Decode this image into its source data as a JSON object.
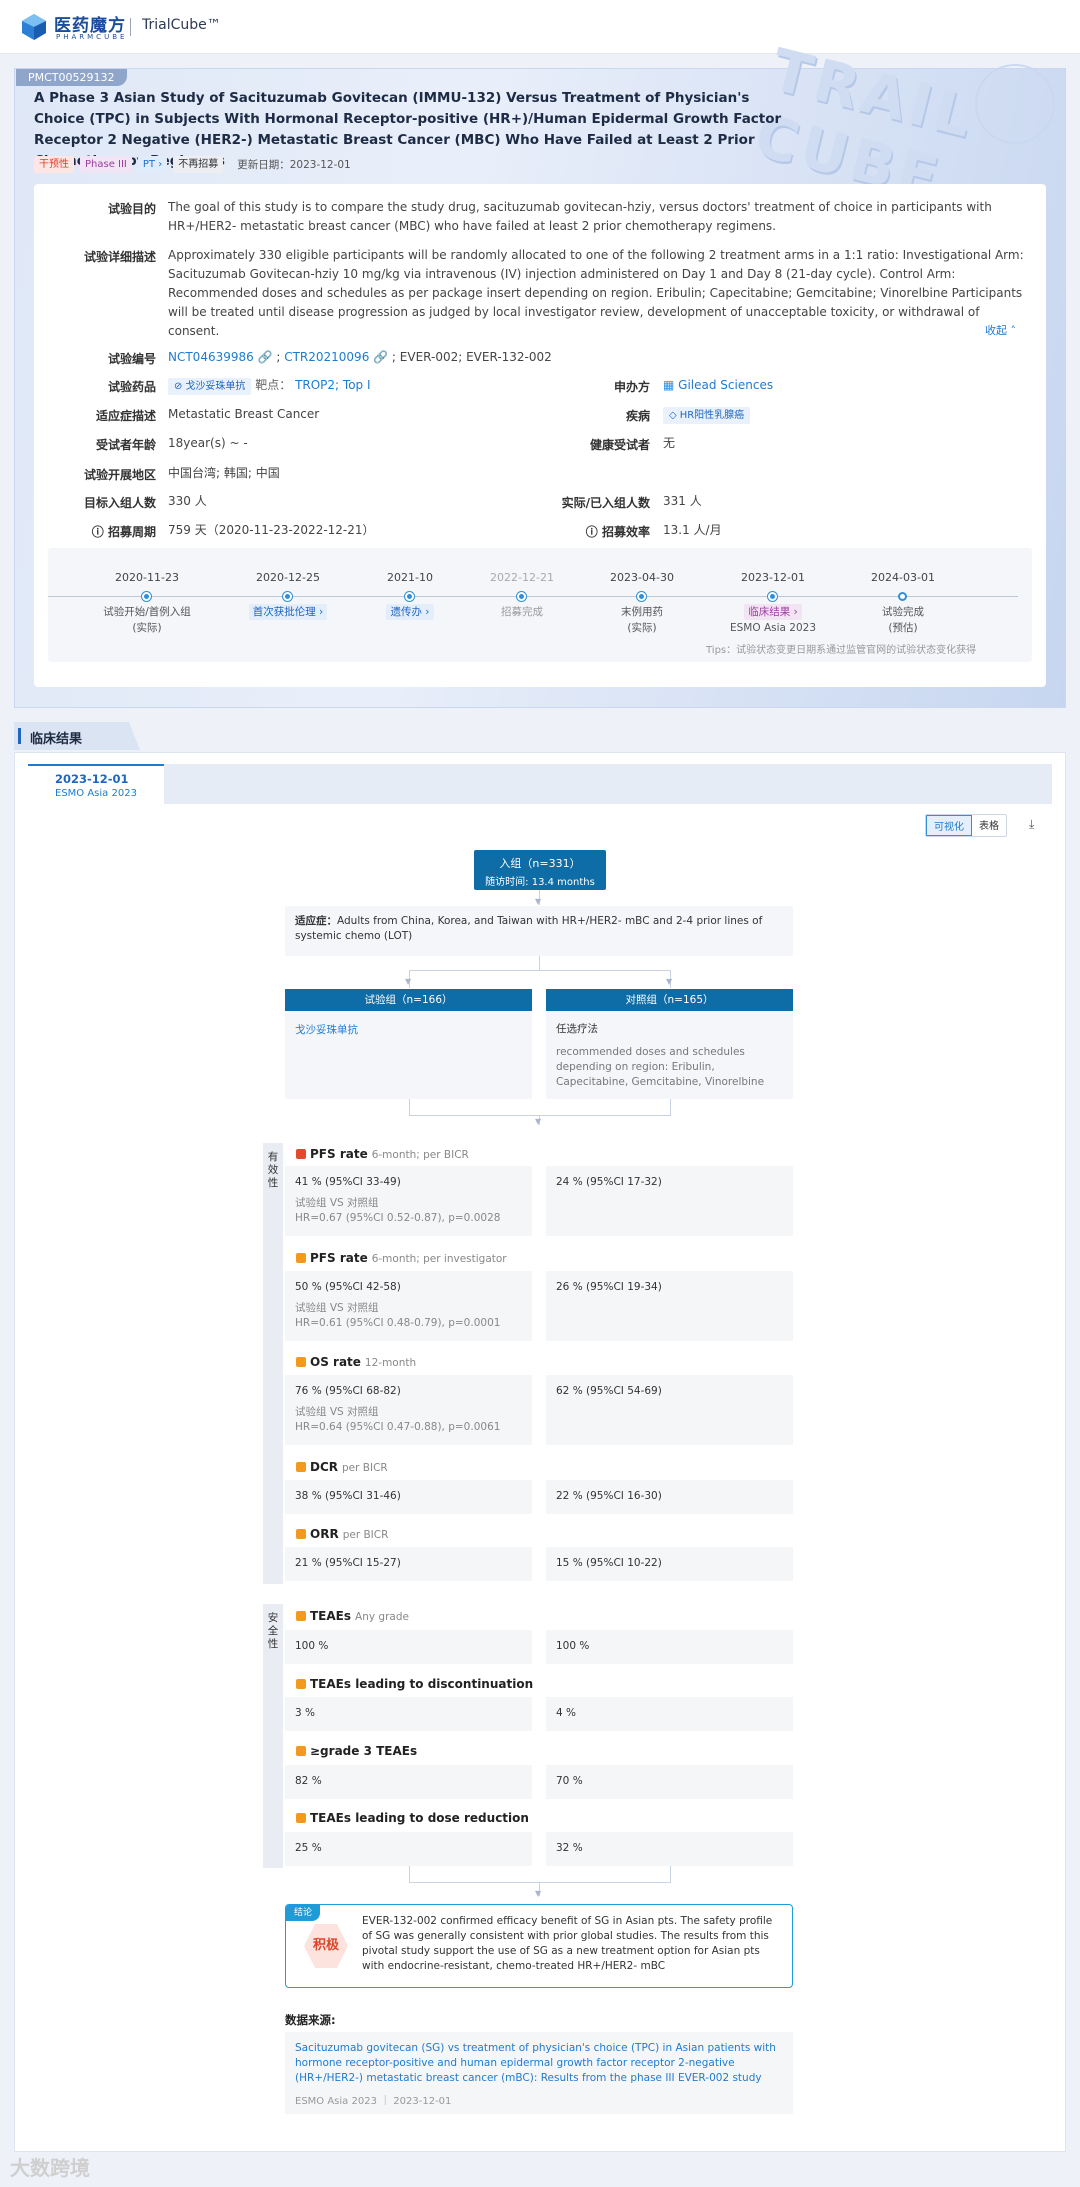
{
  "header": {
    "logo_cn": "医药魔方",
    "logo_en": "PHARMCUBE",
    "product": "TrialCube™"
  },
  "trial": {
    "id": "PMCT00529132",
    "title": "A Phase 3 Asian Study of Sacituzumab Govitecan (IMMU-132) Versus Treatment of Physician's Choice (TPC) in Subjects With Hormonal Receptor-positive (HR+)/Human Epidermal Growth Factor Receptor 2 Negative (HER2-) Metastatic Breast Cancer (MBC) Who Have Failed at Least 2 Prior Chemotherapy Regimens",
    "badges": [
      "干预性",
      "Phase III",
      "PT",
      "不再招募"
    ],
    "updated": "更新日期：2023-12-01",
    "trail_text": "TRAIL CUBE",
    "purpose_label": "试验目的",
    "purpose": "The goal of this study is to compare the study drug, sacituzumab govitecan-hziy, versus doctors' treatment of choice in participants with HR+/HER2- metastatic breast cancer (MBC) who have failed at least 2 prior chemotherapy regimens.",
    "desc_label": "试验详细描述",
    "desc": "Approximately 330 eligible participants will be randomly allocated to one of the following 2 treatment arms in a 1:1 ratio: Investigational Arm: Sacituzumab Govitecan-hziy 10 mg/kg via intravenous (IV) injection administered on Day 1 and Day 8 (21-day cycle). Control Arm: Recommended doses and schedules as per package insert depending on region. Eribulin; Capecitabine; Gemcitabine; Vinorelbine Participants will be treated until disease progression as judged by local investigator review, development of unacceptable toxicity, or withdrawal of consent.",
    "collapse": "收起",
    "reg_label": "试验编号",
    "reg_nct": "NCT04639986",
    "reg_ctr": "CTR20210096",
    "reg_other": "; EVER-002; EVER-132-002",
    "drug_label": "试验药品",
    "drug_chip": "戈沙妥珠单抗",
    "target_label": "靶点：",
    "target": "TROP2; Top I",
    "sponsor_label": "申办方",
    "sponsor": "Gilead Sciences",
    "indication_label": "适应症描述",
    "indication": "Metastatic Breast Cancer",
    "disease_label": "疾病",
    "disease": "HR阳性乳腺癌",
    "age_label": "受试者年龄",
    "age": "18year(s) ~ -",
    "healthy_label": "健康受试者",
    "healthy": "无",
    "region_label": "试验开展地区",
    "region": "中国台湾; 韩国; 中国",
    "target_n_label": "目标入组人数",
    "target_n": "330 人",
    "actual_n_label": "实际/已入组人数",
    "actual_n": "331 人",
    "period_label": "招募周期",
    "period": "759 天（2020-11-23-2022-12-21）",
    "eff_label": "招募效率",
    "eff": "13.1 人/月",
    "timeline": [
      {
        "date": "2020-11-23",
        "label": "试验开始/首例入组",
        "sub": "(实际)",
        "chip": ""
      },
      {
        "date": "2020-12-25",
        "label": "",
        "sub": "",
        "chip": "首次获批伦理"
      },
      {
        "date": "2021-10",
        "label": "",
        "sub": "",
        "chip": "遗传办"
      },
      {
        "date": "2022-12-21",
        "label": "招募完成",
        "sub": "",
        "chip": ""
      },
      {
        "date": "2023-04-30",
        "label": "末例用药",
        "sub": "(实际)",
        "chip": ""
      },
      {
        "date": "2023-12-01",
        "label": "ESMO Asia 2023",
        "sub": "",
        "chip": "临床结果"
      },
      {
        "date": "2024-03-01",
        "label": "试验完成",
        "sub": "(预估)",
        "chip": ""
      }
    ],
    "tips": "Tips：试验状态变更日期系通过监管官网的试验状态变化获得"
  },
  "results": {
    "section_title": "临床结果",
    "tab_date": "2023-12-01",
    "tab_sub": "ESMO Asia 2023",
    "toggle_visual": "可视化",
    "toggle_table": "表格",
    "enroll_title": "入组（n=331）",
    "enroll_sub": "随访时间: 13.4 months",
    "indication_label": "适应症：",
    "indication": "Adults from China, Korea, and Taiwan with HR+/HER2- mBC and 2-4 prior lines of systemic chemo (LOT)",
    "arm_exp": "试验组（n=166）",
    "arm_ctl": "对照组（n=165）",
    "arm_exp_drug": "戈沙妥珠单抗",
    "arm_ctl_drug": "任选疗法",
    "arm_ctl_desc": "recommended doses and schedules depending on region: Eribulin, Capecitabine, Gemcitabine, Vinorelbine",
    "efficacy_label": "有效性",
    "safety_label": "安全性",
    "efficacy": [
      {
        "name": "PFS rate",
        "sub": "6-month; per BICR",
        "exp": "41 % (95%CI 33-49)",
        "cmp": "试验组 VS 对照组",
        "hr": "HR=0.67 (95%CI 0.52-0.87), p=0.0028",
        "ctl": "24 % (95%CI 17-32)"
      },
      {
        "name": "PFS rate",
        "sub": "6-month; per investigator",
        "exp": "50 % (95%CI 42-58)",
        "cmp": "试验组 VS 对照组",
        "hr": "HR=0.61 (95%CI 0.48-0.79), p=0.0001",
        "ctl": "26 % (95%CI 19-34)"
      },
      {
        "name": "OS rate",
        "sub": "12-month",
        "exp": "76 % (95%CI 68-82)",
        "cmp": "试验组 VS 对照组",
        "hr": "HR=0.64 (95%CI 0.47-0.88), p=0.0061",
        "ctl": "62 % (95%CI 54-69)"
      },
      {
        "name": "DCR",
        "sub": "per BICR",
        "exp": "38 % (95%CI 31-46)",
        "cmp": "",
        "hr": "",
        "ctl": "22 % (95%CI 16-30)"
      },
      {
        "name": "ORR",
        "sub": "per BICR",
        "exp": "21 % (95%CI 15-27)",
        "cmp": "",
        "hr": "",
        "ctl": "15 % (95%CI 10-22)"
      }
    ],
    "safety": [
      {
        "name": "TEAEs",
        "sub": "Any grade",
        "exp": "100 %",
        "ctl": "100 %"
      },
      {
        "name": "TEAEs leading to discontinuation",
        "sub": "",
        "exp": "3 %",
        "ctl": "4 %"
      },
      {
        "name": "≥grade 3 TEAEs",
        "sub": "",
        "exp": "82 %",
        "ctl": "70 %"
      },
      {
        "name": "TEAEs leading to dose reduction",
        "sub": "",
        "exp": "25 %",
        "ctl": "32 %"
      }
    ],
    "concl_tag": "结论",
    "concl_badge": "积极",
    "conclusion": "EVER-132-002 confirmed efficacy benefit of SG in Asian pts. The safety profile of SG was generally consistent with prior global studies. The results from this pivotal study support the use of SG as a new treatment option for Asian pts with endocrine-resistant, chemo-treated HR+/HER2- mBC",
    "source_label": "数据来源:",
    "source_title": "Sacituzumab govitecan (SG) vs treatment of physician's choice (TPC) in Asian patients with hormone receptor-positive and human epidermal growth factor receptor 2-negative (HR+/HER2-) metastatic breast cancer (mBC): Results from the phase III EVER-002 study",
    "source_meta": "ESMO Asia 2023 ｜ 2023-12-01"
  },
  "watermark": "大数跨境"
}
